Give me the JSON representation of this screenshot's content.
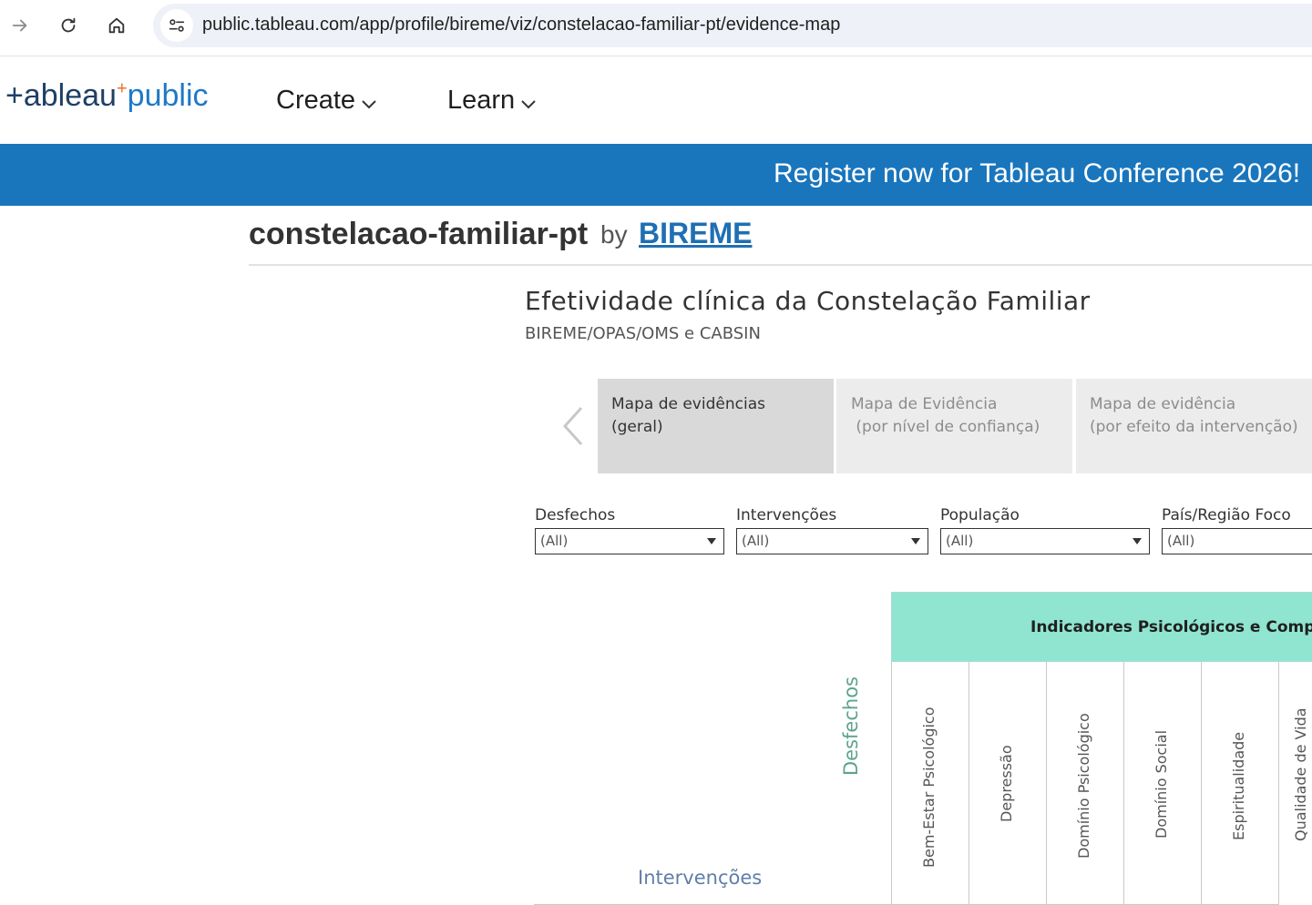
{
  "browser": {
    "url": "public.tableau.com/app/profile/bireme/viz/constelacao-familiar-pt/evidence-map"
  },
  "header": {
    "logo_part1": "+ableau",
    "logo_plus": "+",
    "logo_part2": "public",
    "menu": [
      {
        "label": "Create"
      },
      {
        "label": "Learn"
      }
    ]
  },
  "banner": {
    "text": "Register now for Tableau Conference 2026! →"
  },
  "viz": {
    "name": "constelacao-familiar-pt",
    "by": "by",
    "author": "BIREME"
  },
  "dashboard": {
    "title": "Efetividade clínica da Constelação Familiar",
    "subtitle": "BIREME/OPAS/OMS e CABSIN",
    "tabs": [
      {
        "line1": "Mapa de evidências",
        "line2": "(geral)"
      },
      {
        "line1": "Mapa de Evidência",
        "line2": " (por nível de confiança)"
      },
      {
        "line1": "Mapa de evidência",
        "line2": "(por efeito da intervenção)"
      }
    ],
    "filters": [
      {
        "label": "Desfechos",
        "value": "(All)"
      },
      {
        "label": "Intervenções",
        "value": "(All)"
      },
      {
        "label": "População",
        "value": "(All)"
      },
      {
        "label": "País/Região Foco",
        "value": "(All)"
      }
    ],
    "matrix": {
      "group_header": "Indicadores Psicológicos e Comportamentais",
      "columns": [
        "Bem-Estar Psicológico",
        "Depressão",
        "Domínio Psicológico",
        "Domínio Social",
        "Espiritualidade",
        "Qualidade de Vida"
      ],
      "axis_rows": "Desfechos",
      "axis_cols": "Intervenções"
    }
  },
  "colors": {
    "banner": "#1976bd",
    "group_header": "#8fe5cf",
    "axis_desfechos": "#5ca38e",
    "axis_intervencoes": "#5f7fa8",
    "author_link": "#1f6fb3"
  }
}
